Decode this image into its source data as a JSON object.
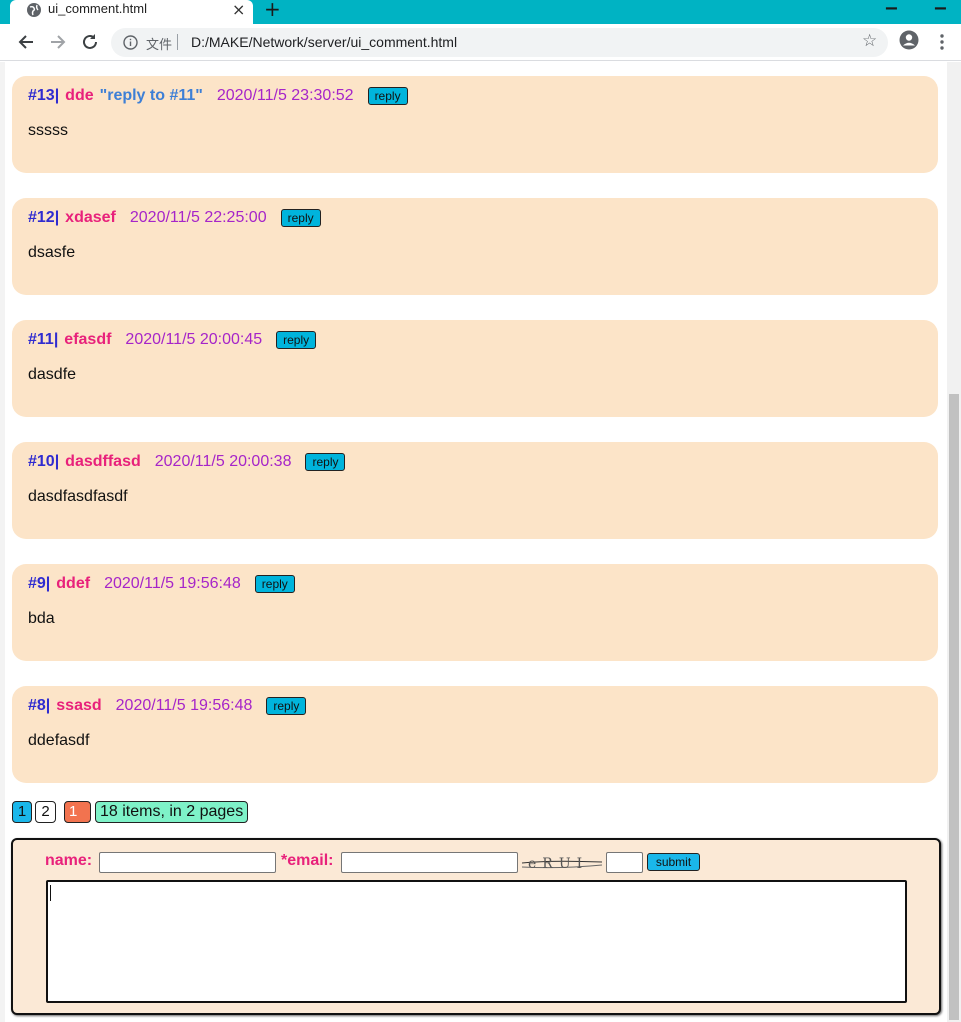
{
  "browser": {
    "tab_title": "ui_comment.html",
    "tab_close": "×",
    "new_tab": "+",
    "scheme_label": "文件",
    "url": "D:/MAKE/Network/server/ui_comment.html"
  },
  "comments": [
    {
      "num": "#13|",
      "name": "dde",
      "reply_to": "\"reply to #11\"",
      "date": "2020/11/5 23:30:52",
      "reply_label": "reply",
      "body": "sssss"
    },
    {
      "num": "#12|",
      "name": "xdasef",
      "reply_to": "",
      "date": "2020/11/5 22:25:00",
      "reply_label": "reply",
      "body": "dsasfe"
    },
    {
      "num": "#11|",
      "name": "efasdf",
      "reply_to": "",
      "date": "2020/11/5 20:00:45",
      "reply_label": "reply",
      "body": "dasdfe"
    },
    {
      "num": "#10|",
      "name": "dasdffasd",
      "reply_to": "",
      "date": "2020/11/5 20:00:38",
      "reply_label": "reply",
      "body": "dasdfasdfasdf"
    },
    {
      "num": "#9|",
      "name": "ddef",
      "reply_to": "",
      "date": "2020/11/5 19:56:48",
      "reply_label": "reply",
      "body": "bda"
    },
    {
      "num": "#8|",
      "name": "ssasd",
      "reply_to": "",
      "date": "2020/11/5 19:56:48",
      "reply_label": "reply",
      "body": "ddefasdf"
    }
  ],
  "pager": {
    "page1": "1",
    "page2": "2",
    "current": "1",
    "info": "18 items, in 2 pages"
  },
  "form": {
    "name_label": "name:",
    "email_label": "*email:",
    "submit_label": "submit",
    "captcha_text": "eRUI",
    "name_value": "",
    "email_value": "",
    "captcha_value": "",
    "content_value": ""
  },
  "colors": {
    "tab_bar": "#00b3c3",
    "comment_bg": "#fce4c8",
    "num": "#2f2bd0",
    "name": "#e8217b",
    "reply_to": "#3d7fd6",
    "date": "#a625c9",
    "button": "#00b4dc"
  },
  "icons": [
    "globe-icon",
    "close-icon",
    "plus-icon",
    "back-arrow-icon",
    "forward-arrow-icon",
    "reload-icon",
    "info-icon",
    "star-icon",
    "account-icon",
    "more-vert-icon"
  ]
}
